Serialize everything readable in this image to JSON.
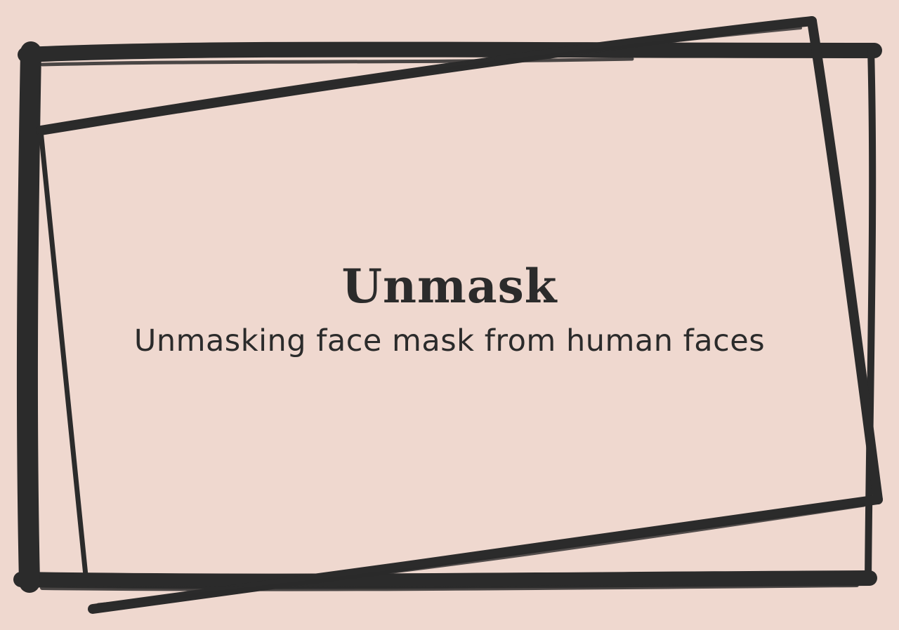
{
  "slide": {
    "title": "Unmask",
    "subtitle": "Unmasking face mask from human faces"
  },
  "colors": {
    "background": "#efd8cf",
    "ink": "#2b2b2b"
  },
  "decorations": {
    "frame": "hand-drawn-double-rectangle-frame"
  }
}
